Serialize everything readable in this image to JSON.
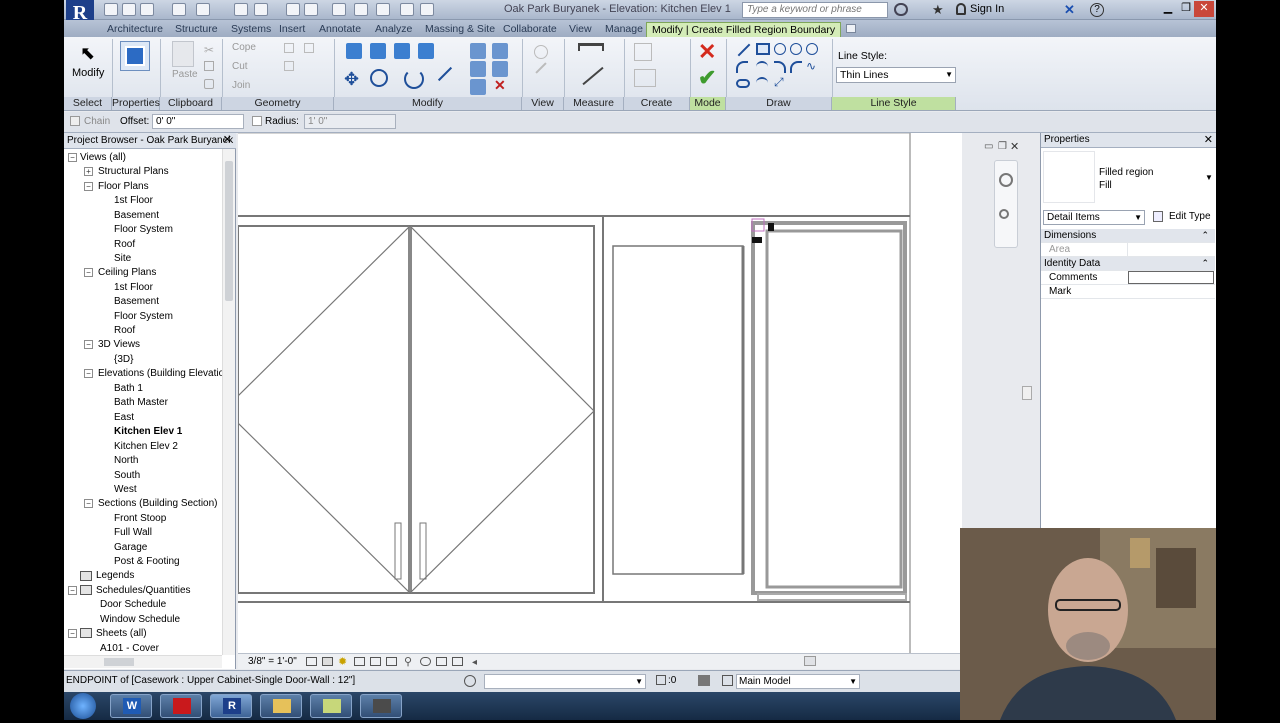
{
  "app": {
    "title": "Oak Park Buryanek - Elevation: Kitchen Elev 1",
    "logo": "R",
    "search_placeholder": "Type a keyword or phrase",
    "sign_in": "Sign In"
  },
  "tabs": [
    {
      "label": "Architecture"
    },
    {
      "label": "Structure"
    },
    {
      "label": "Systems"
    },
    {
      "label": "Insert"
    },
    {
      "label": "Annotate"
    },
    {
      "label": "Analyze"
    },
    {
      "label": "Massing & Site"
    },
    {
      "label": "Collaborate"
    },
    {
      "label": "View"
    },
    {
      "label": "Manage"
    },
    {
      "label": "Modify | Create Filled Region Boundary"
    }
  ],
  "ribbon": {
    "modify_label": "Modify",
    "paste_label": "Paste",
    "cope_label": "Cope",
    "cut_label": "Cut",
    "join_label": "Join",
    "line_style_title": "Line Style:",
    "line_style_value": "Thin Lines",
    "panels": {
      "select": "Select",
      "properties": "Properties",
      "clipboard": "Clipboard",
      "geometry": "Geometry",
      "modify": "Modify",
      "view": "View",
      "measure": "Measure",
      "create": "Create",
      "mode": "Mode",
      "draw": "Draw",
      "line_style": "Line Style"
    }
  },
  "options_bar": {
    "chain_label": "Chain",
    "offset_label": "Offset:",
    "offset_value": "0'  0\"",
    "radius_label": "Radius:",
    "radius_value": "1'  0\""
  },
  "browser": {
    "title": "Project Browser - Oak Park Buryanek",
    "items": [
      {
        "label": "Views (all)"
      },
      {
        "label": "Structural Plans"
      },
      {
        "label": "Floor Plans"
      },
      {
        "label": "1st Floor"
      },
      {
        "label": "Basement"
      },
      {
        "label": "Floor System"
      },
      {
        "label": "Roof"
      },
      {
        "label": "Site"
      },
      {
        "label": "Ceiling Plans"
      },
      {
        "label": "1st Floor"
      },
      {
        "label": "Basement"
      },
      {
        "label": "Floor System"
      },
      {
        "label": "Roof"
      },
      {
        "label": "3D Views"
      },
      {
        "label": "{3D}"
      },
      {
        "label": "Elevations (Building Elevatio"
      },
      {
        "label": "Bath 1"
      },
      {
        "label": "Bath Master"
      },
      {
        "label": "East"
      },
      {
        "label": "Kitchen Elev 1"
      },
      {
        "label": "Kitchen Elev 2"
      },
      {
        "label": "North"
      },
      {
        "label": "South"
      },
      {
        "label": "West"
      },
      {
        "label": "Sections (Building Section)"
      },
      {
        "label": "Front Stoop"
      },
      {
        "label": "Full Wall"
      },
      {
        "label": "Garage"
      },
      {
        "label": "Post & Footing"
      },
      {
        "label": "Legends"
      },
      {
        "label": "Schedules/Quantities"
      },
      {
        "label": "Door Schedule"
      },
      {
        "label": "Window Schedule"
      },
      {
        "label": "Sheets (all)"
      },
      {
        "label": "A101 - Cover"
      }
    ]
  },
  "view_bar": {
    "scale": "3/8\" = 1'-0\""
  },
  "properties": {
    "title": "Properties",
    "type_name": "Filled region",
    "type_sub": "Fill",
    "selector": "Detail Items",
    "edit_type": "Edit Type",
    "groups": [
      {
        "label": "Dimensions",
        "rows": [
          {
            "label": "Area",
            "value": ""
          }
        ]
      },
      {
        "label": "Identity Data",
        "rows": [
          {
            "label": "Comments",
            "value": ""
          },
          {
            "label": "Mark",
            "value": ""
          }
        ]
      }
    ]
  },
  "status": {
    "text": "ENDPOINT  of [Casework : Upper Cabinet-Single Door-Wall : 12\"]",
    "filter_count": ":0",
    "model": "Main Model"
  },
  "colors": {
    "accent_green": "#d4ecb8",
    "ribbon_blue": "#b7c3d6"
  }
}
